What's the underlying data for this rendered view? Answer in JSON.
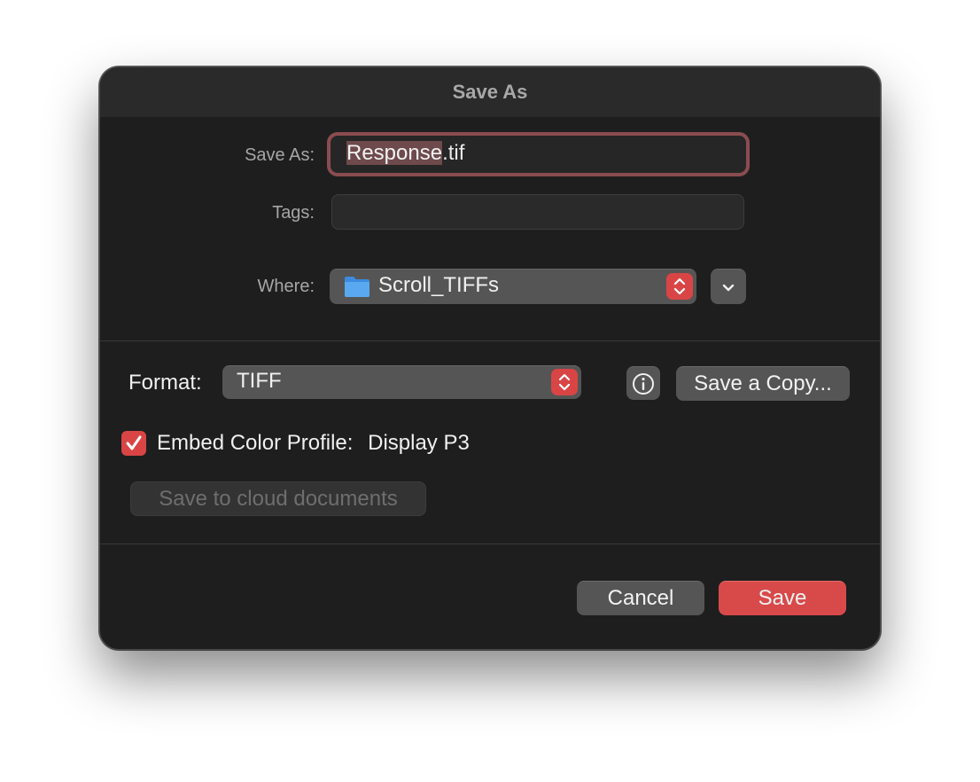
{
  "dialog": {
    "title": "Save As"
  },
  "save_as": {
    "label": "Save As:",
    "value_selected": "Response",
    "value_extension": ".tif"
  },
  "tags": {
    "label": "Tags:",
    "value": ""
  },
  "where": {
    "label": "Where:",
    "folder": "Scroll_TIFFs"
  },
  "format": {
    "label": "Format:",
    "selected": "TIFF",
    "save_copy_label": "Save a Copy..."
  },
  "embed_profile": {
    "label": "Embed Color Profile:",
    "profile": "Display P3",
    "checked": true
  },
  "cloud": {
    "label": "Save to cloud documents"
  },
  "footer": {
    "cancel_label": "Cancel",
    "save_label": "Save"
  },
  "colors": {
    "accent": "#d94545",
    "focus_ring": "#8b4c50",
    "dialog_bg": "#1e1e1e",
    "folder_icon": "#5aa9f0"
  },
  "icons": [
    "folder-icon",
    "chevron-up-down-icon",
    "chevron-down-icon",
    "info-icon",
    "checkmark-icon"
  ]
}
